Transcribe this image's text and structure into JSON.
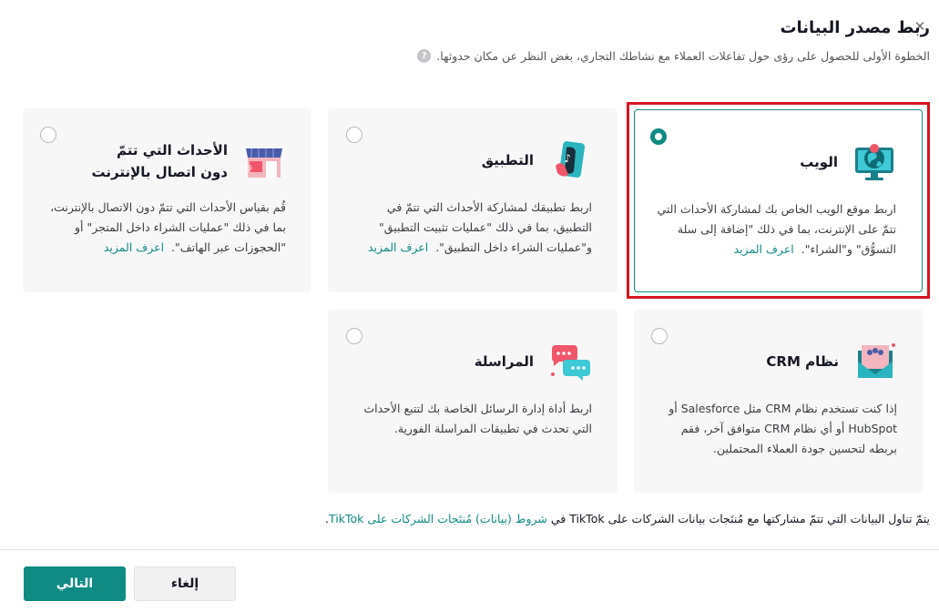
{
  "dialog": {
    "title": "ربط مصدر البيانات",
    "subtitle": "الخطوة الأولى للحصول على رؤى حول تفاعلات العملاء مع نشاطك التجاري، بغض النظر عن مكان حدوثها.",
    "close_glyph": "✕",
    "help_glyph": "?"
  },
  "cards": {
    "web": {
      "title": "الويب",
      "desc": "اربط موقع الويب الخاص بك لمشاركة الأحداث التي تتمّ على الإنترنت، بما في ذلك \"إضافة إلى سلة التسوُّق\" و\"الشراء\".",
      "learn_more": "اعرف المزيد",
      "selected": true,
      "icon": "globe-monitor-icon"
    },
    "app": {
      "title": "التطبيق",
      "desc": "اربط تطبيقك لمشاركة الأحداث التي تتمّ في التطبيق، بما في ذلك \"عمليات تثبيت التطبيق\" و\"عمليات الشراء داخل التطبيق\".",
      "learn_more": "اعرف المزيد",
      "selected": false,
      "icon": "phone-app-icon"
    },
    "offline": {
      "title": "الأحداث التي تتمّ دون اتصال بالإنترنت",
      "desc": "قُم بقياس الأحداث التي تتمّ دون الاتصال بالإنترنت، بما في ذلك \"عمليات الشراء داخل المتجر\" أو \"الحجوزات عبر الهاتف\".",
      "learn_more": "اعرف المزيد",
      "selected": false,
      "icon": "store-icon"
    },
    "crm": {
      "title": "نظام CRM",
      "desc": "إذا كنت تستخدم نظام CRM مثل Salesforce أو HubSpot أو أي نظام CRM متوافق آخر، فقم بربطه لتحسين جودة العملاء المحتملين.",
      "selected": false,
      "icon": "crm-envelope-icon"
    },
    "messaging": {
      "title": "المراسلة",
      "desc": "اربط أداة إدارة الرسائل الخاصة بك لتتبع الأحداث التي تحدث في تطبيقات المراسلة الفورية.",
      "selected": false,
      "icon": "chat-bubbles-icon"
    }
  },
  "footer": {
    "note_before": "يتمّ تناول البيانات التي تتمّ مشاركتها مع مُنتَجات بيانات الشركات على TikTok في ",
    "note_link": "شروط (بيانات) مُنتَجات الشركات على TikTok",
    "note_after": ".",
    "next_label": "التالي",
    "cancel_label": "إلغاء"
  },
  "colors": {
    "accent": "#0f8b84",
    "highlight": "#d9141f",
    "card_bg": "#f7f7f8"
  }
}
